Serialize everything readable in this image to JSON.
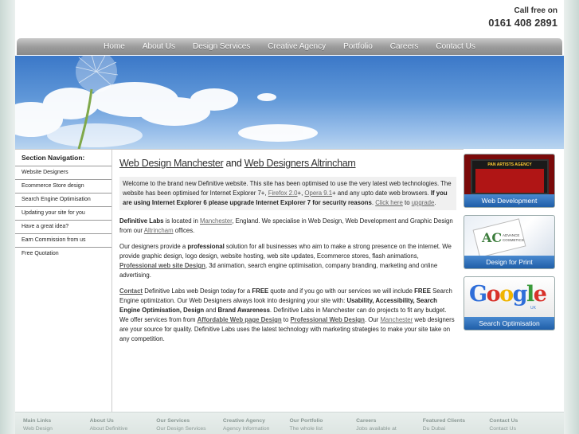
{
  "header": {
    "call_line1": "Call free on",
    "call_line2": "0161 408 2891"
  },
  "nav": [
    "Home",
    "About Us",
    "Design Services",
    "Creative Agency",
    "Portfolio",
    "Careers",
    "Contact Us"
  ],
  "sidebar": {
    "title": "Section Navigation:",
    "items": [
      "Website Designers",
      "Ecommerce Store design",
      "Search Engine Optimisation",
      "Updating your site for you",
      "Have a great idea?",
      "Earn Commission from us",
      "Free Quotation"
    ]
  },
  "main": {
    "h1_part1": "Web Design Manchester",
    "h1_and": " and ",
    "h1_part2": "Web Designers Altrincham",
    "notice": {
      "t1": "Welcome to the brand new Definitive website. This site has been optimised to use the very latest web technologies. The website has been optimised for Internet Explorer 7+, ",
      "firefox": "Firefox 2.0",
      "t2": "+, ",
      "opera": "Opera 9.1",
      "t3": "+ and any upto date web browsers. ",
      "bold": "If you are using Internet Explorer 6 please upgrade Internet Explorer 7 for security reasons",
      "t4": ". ",
      "click": "Click here",
      "t5": " to ",
      "upgrade": "upgrade",
      "t6": "."
    },
    "p1": {
      "b1": "Definitive Labs",
      "t1": " is located in ",
      "l1": "Manchester",
      "t2": ", England. We specialise in Web Design, Web Development and Graphic Design from our ",
      "l2": "Altrincham",
      "t3": " offices."
    },
    "p2": {
      "t1": "Our designers provide a ",
      "b1": "professional",
      "t2": " solution for all businesses who aim to make a strong presence on the internet. We provide graphic design, logo design, website hosting, web site updates, Ecommerce stores, flash animations, ",
      "l1": "Professional web site Design",
      "t3": ", 3d animation, search engine optimisation, company branding, marketing and online advertising."
    },
    "p3": {
      "l1": "Contact",
      "t1": " Definitive Labs web Design today for a ",
      "b1": "FREE",
      "t2": " quote and if you go with our services we will include ",
      "b2": "FREE",
      "t3": " Search Engine optimization. Our Web Designers always look into designing your site with: ",
      "b3": "Usability, Accessibility, Search Engine Optimisation, Design",
      "t4": " and ",
      "b4": "Brand Awareness",
      "t5": ". Definitive Labs in Manchester can do projects to fit any budget. We offer services from from ",
      "l2": "Affordable Web page Design",
      "t6": " to ",
      "l3": "Professional Web Design",
      "t7": ". Our ",
      "l4": "Manchester",
      "t8": " web designers are your source for quality. Definitive Labs uses the latest technology with marketing strategies to make your site take on any competition."
    }
  },
  "promos": {
    "web": {
      "caption": "Web Development",
      "screen_title": "PAN ARTISTS AGENCY"
    },
    "print": {
      "caption": "Design for Print",
      "logo": "AC",
      "logo_text_1": "ADVANCE",
      "logo_text_2": "COSMETICS"
    },
    "seo": {
      "caption": "Search Optimisation",
      "logo": "Google",
      "logo_sub": "UK"
    }
  },
  "footer": [
    {
      "head": "Main Links",
      "item": "Web Design"
    },
    {
      "head": "About Us",
      "item": "About Definitive"
    },
    {
      "head": "Our Services",
      "item": "Our Design Services"
    },
    {
      "head": "Creative Agency",
      "item": "Agency Information"
    },
    {
      "head": "Our Portfolio",
      "item": "The whole list"
    },
    {
      "head": "Careers",
      "item": "Jobs available at"
    },
    {
      "head": "Featured Clients",
      "item": "Du Dubai"
    },
    {
      "head": "Contact Us",
      "item": "Contact Us"
    }
  ],
  "colors": {
    "nav_bg": "#9a9a9a",
    "caption_blue": "#1f5ea8",
    "sky": "#5f97d8"
  }
}
